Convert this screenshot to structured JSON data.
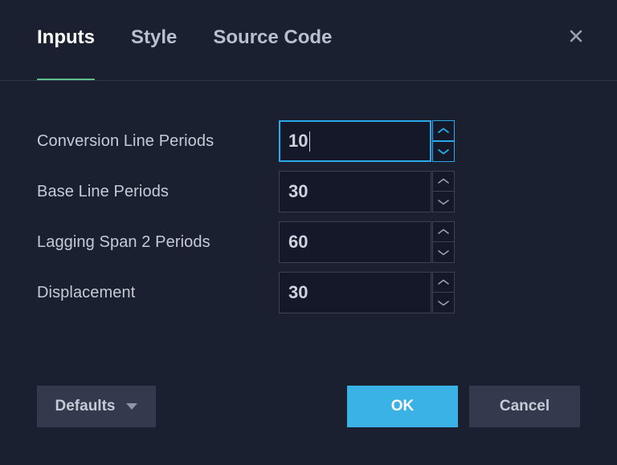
{
  "dialog": {
    "tabs": [
      {
        "id": "inputs",
        "label": "Inputs",
        "active": true
      },
      {
        "id": "style",
        "label": "Style",
        "active": false
      },
      {
        "id": "source-code",
        "label": "Source Code",
        "active": false
      }
    ],
    "close_icon": "close-icon",
    "accent_underline_color": "#5fbf8c"
  },
  "inputs": {
    "fields": [
      {
        "label": "Conversion Line Periods",
        "value": "10",
        "focused": true
      },
      {
        "label": "Base Line Periods",
        "value": "30",
        "focused": false
      },
      {
        "label": "Lagging Span 2 Periods",
        "value": "60",
        "focused": false
      },
      {
        "label": "Displacement",
        "value": "30",
        "focused": false
      }
    ],
    "stepper_up_icon": "chevron-up-icon",
    "stepper_down_icon": "chevron-down-icon",
    "focus_border_color": "#29a9e8"
  },
  "footer": {
    "defaults_label": "Defaults",
    "defaults_caret_icon": "caret-down-icon",
    "ok_label": "OK",
    "cancel_label": "Cancel",
    "ok_color": "#3bb2e5"
  }
}
